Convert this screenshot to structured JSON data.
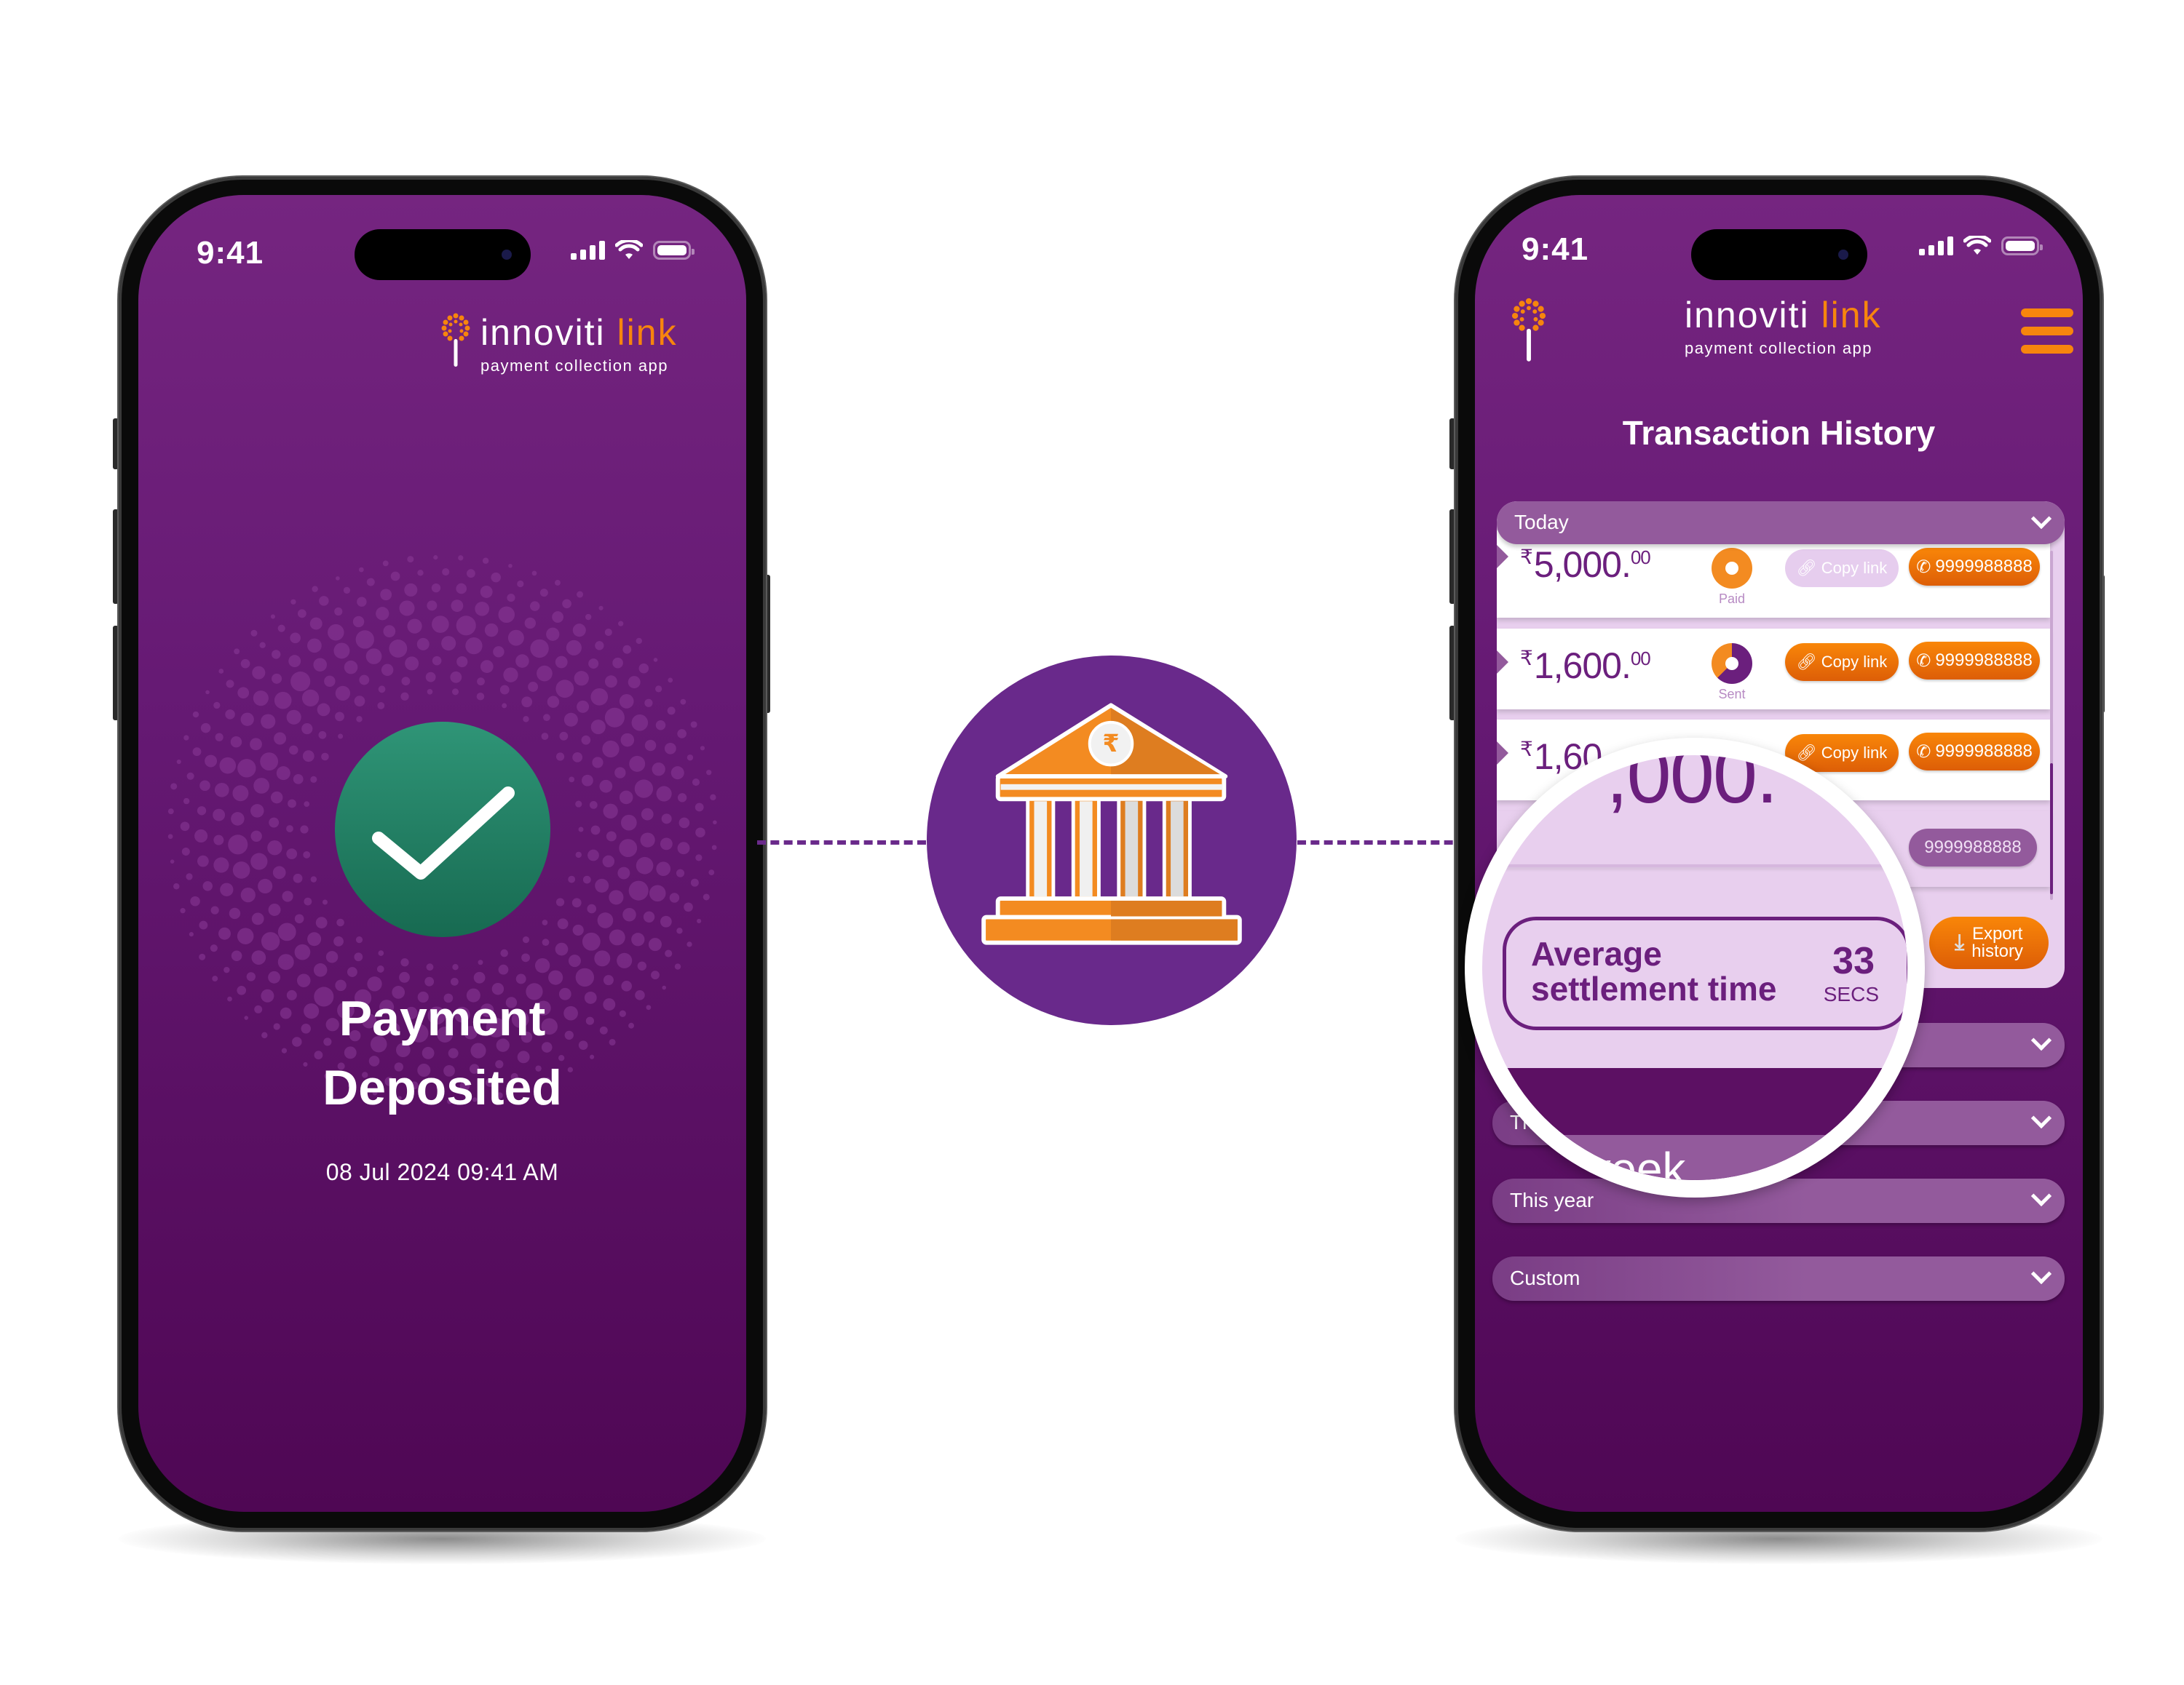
{
  "colors": {
    "brand_purple": "#69298b",
    "screen_top": "#752580",
    "screen_bottom": "#4f0754",
    "accent_orange": "#f7850d",
    "success_green": "#1f7a5e",
    "card_bg": "#e8cfee",
    "header_purple": "#935a9c"
  },
  "left_phone": {
    "status_bar": {
      "time": "9:41",
      "icons": [
        "signal-icon",
        "wifi-icon",
        "battery-icon"
      ]
    },
    "brand": {
      "name": "innoviti",
      "name_accent": "link",
      "tagline": "payment collection app"
    },
    "success_icon": "checkmark-icon",
    "title_line1": "Payment",
    "title_line2": "Deposited",
    "datetime": "08 Jul 2024  09:41 AM"
  },
  "center": {
    "icon": "bank-icon",
    "currency_symbol": "₹"
  },
  "right_phone": {
    "status_bar": {
      "time": "9:41",
      "icons": [
        "signal-icon",
        "wifi-icon",
        "battery-icon"
      ]
    },
    "brand": {
      "name": "innoviti",
      "name_accent": "link",
      "tagline": "payment collection app"
    },
    "menu_icon": "hamburger-icon",
    "page_title": "Transaction History",
    "today_section": {
      "label": "Today",
      "transactions": [
        {
          "currency": "₹",
          "amount": "5,000.",
          "decimals": "00",
          "status": "Paid",
          "copy_label": "Copy link",
          "copy_enabled": false,
          "phone": "9999988888"
        },
        {
          "currency": "₹",
          "amount": "1,600.",
          "decimals": "00",
          "status": "Sent",
          "copy_label": "Copy link",
          "copy_enabled": true,
          "phone": "9999988888"
        },
        {
          "currency": "₹",
          "amount": "1,60",
          "decimals": "",
          "status": "",
          "copy_label": "Copy link",
          "copy_enabled": true,
          "phone": "9999988888"
        },
        {
          "currency": "",
          "amount": "",
          "decimals": "",
          "status": "",
          "copy_label": "",
          "copy_enabled": false,
          "phone": "9999988888"
        }
      ],
      "export_label_line1": "Export",
      "export_label_line2": "history"
    },
    "sections": [
      {
        "label": ""
      },
      {
        "label": "This week"
      },
      {
        "label": "This year"
      },
      {
        "label": "Custom"
      }
    ],
    "magnifier": {
      "amount_fragment": ",000.",
      "stat_label_line1": "Average",
      "stat_label_line2": "settlement time",
      "stat_value": "33",
      "stat_unit": "SECS",
      "section_fragment": "week",
      "section_prefix": "Th"
    }
  }
}
